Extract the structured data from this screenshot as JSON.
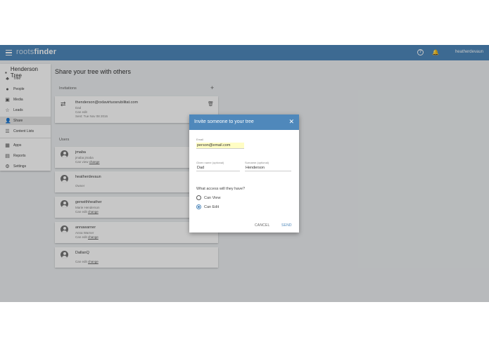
{
  "header": {
    "logo_part1": "roots",
    "logo_part2": "finder",
    "username": "heatherdevaun",
    "help_glyph": "?",
    "bell_glyph": "🔔"
  },
  "sidebar": {
    "tree_name": "Henderson Tree",
    "items": [
      {
        "label": "Tree",
        "icon": "tree-icon",
        "glyph": "♣"
      },
      {
        "label": "People",
        "icon": "person-icon",
        "glyph": "●"
      },
      {
        "label": "Media",
        "icon": "image-icon",
        "glyph": "▣"
      },
      {
        "label": "Leads",
        "icon": "star-icon",
        "glyph": "☆"
      },
      {
        "label": "Share",
        "icon": "share-icon",
        "glyph": "👤"
      },
      {
        "label": "Content Lists",
        "icon": "list-icon",
        "glyph": "☰"
      },
      {
        "label": "Apps",
        "icon": "apps-icon",
        "glyph": "▦"
      },
      {
        "label": "Reports",
        "icon": "print-icon",
        "glyph": "▤"
      },
      {
        "label": "Settings",
        "icon": "gear-icon",
        "glyph": "⚙"
      }
    ]
  },
  "main": {
    "title": "Share your tree with others",
    "invitations_label": "Invitations",
    "add_glyph": "+",
    "invitation": {
      "email": "thenderson@oxlavirtuosrubilitat.com",
      "name": "Dad",
      "access": "Can edit",
      "sent": "Sent: Tue Nov 08 2016"
    },
    "users_label": "Users",
    "users": [
      {
        "name": "jmaba",
        "sub": "jmaba jmaba",
        "access": "Can view",
        "change": "change"
      },
      {
        "name": "heatherdevaun",
        "sub": "Owner",
        "access": "",
        "change": ""
      },
      {
        "name": "genwithheather",
        "sub": "Marie Henderson",
        "access": "Can edit",
        "change": "change"
      },
      {
        "name": "annawarner",
        "sub": "Anna Warner",
        "access": "Can edit",
        "change": "change"
      },
      {
        "name": "DallanQ",
        "sub": "",
        "access": "Can edit",
        "change": "change"
      }
    ]
  },
  "dialog": {
    "title": "Invite someone to your tree",
    "close_glyph": "✕",
    "email_label": "Email",
    "email_value": "person@email.com",
    "given_label": "Given name (optional)",
    "given_value": "Dad",
    "surname_label": "Surname (optional)",
    "surname_value": "Henderson",
    "question": "What access will they have?",
    "options": [
      {
        "label": "Can View",
        "selected": false
      },
      {
        "label": "Can Edit",
        "selected": true
      }
    ],
    "cancel_label": "CANCEL",
    "send_label": "SEND"
  },
  "colors": {
    "brand": "#4f88bb",
    "email_highlight": "#fffdc4"
  }
}
